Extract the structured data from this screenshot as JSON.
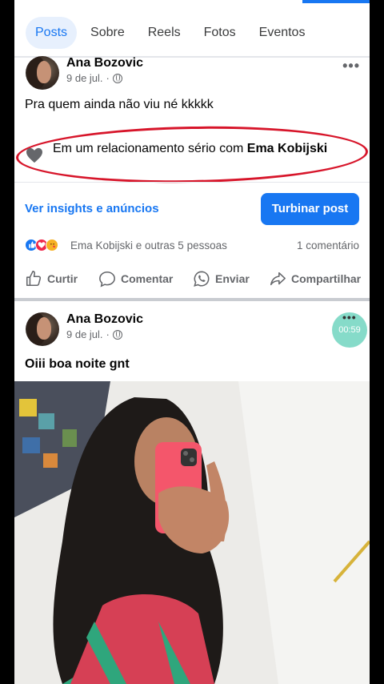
{
  "tabs": [
    {
      "label": "Posts"
    },
    {
      "label": "Sobre"
    },
    {
      "label": "Reels"
    },
    {
      "label": "Fotos"
    },
    {
      "label": "Eventos"
    }
  ],
  "post1": {
    "author": "Ana Bozovic",
    "date": "9 de jul.",
    "text": "Pra quem ainda não viu né kkkkk",
    "relationship_prefix": "Em um relacionamento sério com ",
    "relationship_name": "Ema Kobijski",
    "insights_label": "Ver insights e anúncios",
    "boost_label": "Turbinar post",
    "reactions_text": "Ema Kobijski e outras 5 pessoas",
    "comment_count": "1 comentário",
    "actions": {
      "like": "Curtir",
      "comment": "Comentar",
      "send": "Enviar",
      "share": "Compartilhar"
    }
  },
  "post2": {
    "author": "Ana Bozovic",
    "date": "9 de jul.",
    "text": "Oiii boa noite gnt",
    "timer": "00:59"
  },
  "colors": {
    "accent": "#1877f2",
    "annotation_red": "#d7152a",
    "timer_bg": "#86dbc9"
  }
}
